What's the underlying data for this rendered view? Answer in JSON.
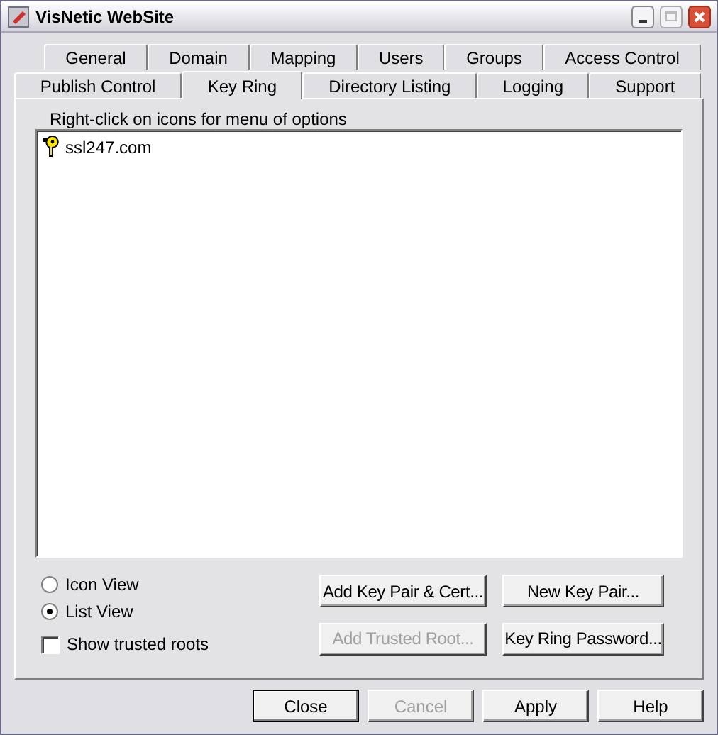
{
  "window": {
    "title": "VisNetic WebSite"
  },
  "tab_rows": [
    [
      {
        "label": "General",
        "selected": false
      },
      {
        "label": "Domain",
        "selected": false
      },
      {
        "label": "Mapping",
        "selected": false
      },
      {
        "label": "Users",
        "selected": false
      },
      {
        "label": "Groups",
        "selected": false
      },
      {
        "label": "Access Control",
        "selected": false
      }
    ],
    [
      {
        "label": "Publish Control",
        "selected": false
      },
      {
        "label": "Key Ring",
        "selected": true
      },
      {
        "label": "Directory Listing",
        "selected": false
      },
      {
        "label": "Logging",
        "selected": false
      },
      {
        "label": "Support",
        "selected": false
      }
    ]
  ],
  "hint": "Right-click on icons for menu of options",
  "key_list": [
    {
      "label": "ssl247.com",
      "selected": false
    }
  ],
  "view_options": [
    {
      "label": "Icon View",
      "selected": false
    },
    {
      "label": "List View",
      "selected": true
    }
  ],
  "show_trusted_roots": {
    "label": "Show trusted roots",
    "checked": false
  },
  "key_buttons": [
    {
      "label": "Add Key Pair & Cert...",
      "disabled": false
    },
    {
      "label": "New Key Pair...",
      "disabled": false
    },
    {
      "label": "Add Trusted Root...",
      "disabled": true
    },
    {
      "label": "Key Ring Password...",
      "disabled": false
    }
  ],
  "dialog_buttons": [
    {
      "label": "Close",
      "disabled": false,
      "default": true
    },
    {
      "label": "Cancel",
      "disabled": true,
      "default": false
    },
    {
      "label": "Apply",
      "disabled": false,
      "default": false
    },
    {
      "label": "Help",
      "disabled": false,
      "default": false
    }
  ]
}
